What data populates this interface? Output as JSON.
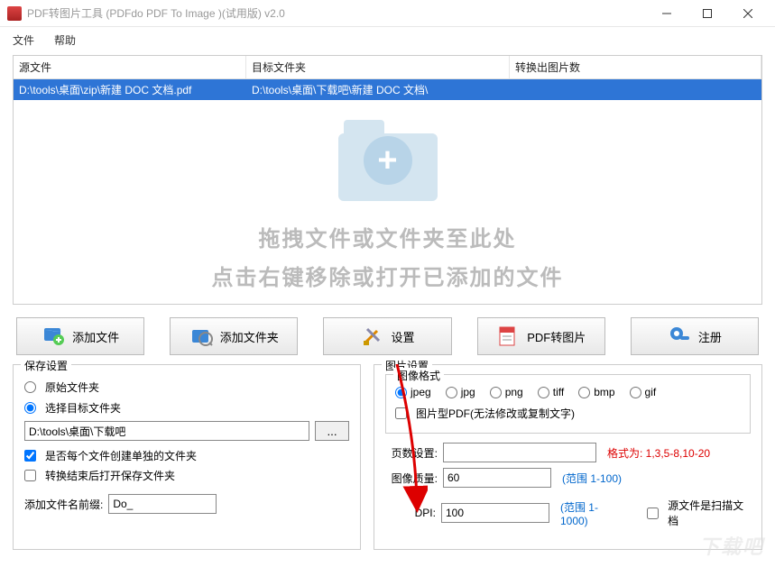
{
  "window": {
    "title": "PDF转图片工具 (PDFdo PDF To Image )(试用版) v2.0"
  },
  "menu": {
    "file": "文件",
    "help": "帮助"
  },
  "table": {
    "headers": {
      "source": "源文件",
      "target": "目标文件夹",
      "count": "转换出图片数"
    },
    "rows": [
      {
        "source": "D:\\tools\\桌面\\zip\\新建 DOC 文档.pdf",
        "target": "D:\\tools\\桌面\\下载吧\\新建 DOC 文档\\",
        "count": ""
      }
    ]
  },
  "dropzone": {
    "line1": "拖拽文件或文件夹至此处",
    "line2": "点击右键移除或打开已添加的文件"
  },
  "toolbar": {
    "add_file": "添加文件",
    "add_folder": "添加文件夹",
    "settings": "设置",
    "convert": "PDF转图片",
    "register": "注册"
  },
  "save": {
    "legend": "保存设置",
    "orig_folder": "原始文件夹",
    "choose_target": "选择目标文件夹",
    "path": "D:\\tools\\桌面\\下载吧",
    "browse": "...",
    "per_file": "是否每个文件创建单独的文件夹",
    "open_after": "转换结束后打开保存文件夹",
    "prefix_label": "添加文件名前缀:",
    "prefix_value": "Do_"
  },
  "image": {
    "legend": "图片设置",
    "fmt_legend": "图像格式",
    "fmt": {
      "jpeg": "jpeg",
      "jpg": "jpg",
      "png": "png",
      "tiff": "tiff",
      "bmp": "bmp",
      "gif": "gif"
    },
    "image_pdf": "图片型PDF(无法修改或复制文字)",
    "page_label": "页数设置:",
    "page_value": "",
    "page_hint": "格式为: 1,3,5-8,10-20",
    "quality_label": "图像质量:",
    "quality_value": "60",
    "quality_hint": "(范围 1-100)",
    "dpi_label": "DPI:",
    "dpi_value": "100",
    "dpi_hint": "(范围 1-1000)",
    "scan_pdf": "源文件是扫描文档"
  },
  "watermark": "下载吧"
}
